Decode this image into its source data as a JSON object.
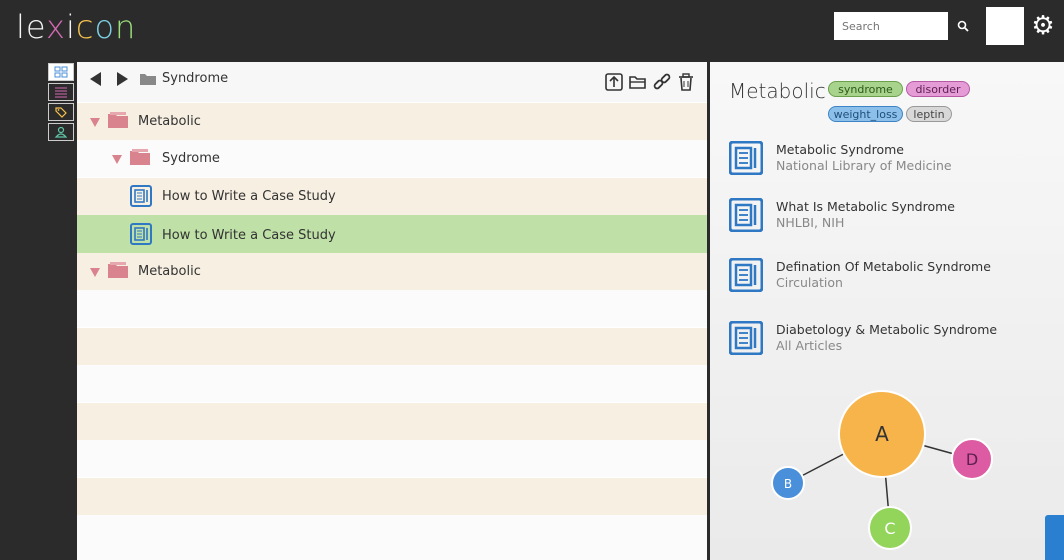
{
  "app": {
    "logo": "lexicon",
    "search_placeholder": "Search"
  },
  "colors": {
    "topbar": "#2b2b2b",
    "row_odd": "#f7efe2",
    "row_selected": "#bfe0a6",
    "folder": "#d9838e",
    "doc_icon": "#2f78c4",
    "tag_syndrome": "#a8d38d",
    "tag_disorder": "#e59bd6",
    "tag_weight_loss": "#8cc0ea",
    "tag_leptin": "#d8d8d8",
    "node_a": "#f6b44b",
    "node_b": "#4a8fd9",
    "node_c": "#93d45a",
    "node_d": "#dd5ba2"
  },
  "breadcrumb": {
    "current": "Syndrome"
  },
  "tree": [
    {
      "label": "Metabolic",
      "type": "folder",
      "level": 0
    },
    {
      "label": "Sydrome",
      "type": "folder",
      "level": 1
    },
    {
      "label": "How to Write a Case Study",
      "type": "doc",
      "level": 2
    },
    {
      "label": "How to Write a Case Study",
      "type": "doc",
      "level": 2,
      "selected": true
    },
    {
      "label": "Metabolic",
      "type": "folder",
      "level": 0
    }
  ],
  "detail": {
    "title": "Metabolic",
    "tags": [
      "syndrome",
      "disorder",
      "weight_loss",
      "leptin"
    ],
    "references": [
      {
        "title": "Metabolic Syndrome",
        "source": "National Library of Medicine"
      },
      {
        "title": "What Is Metabolic Syndrome",
        "source": "NHLBI, NIH"
      },
      {
        "title": "Defination Of Metabolic Syndrome",
        "source": "Circulation"
      },
      {
        "title": "Diabetology & Metabolic Syndrome",
        "source": "All Articles"
      }
    ]
  },
  "graph": {
    "nodes": [
      "A",
      "B",
      "C",
      "D"
    ]
  }
}
